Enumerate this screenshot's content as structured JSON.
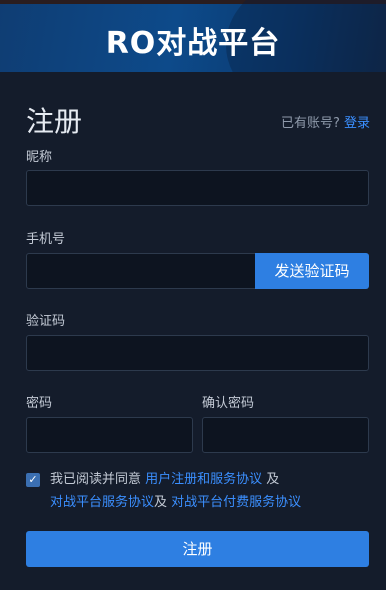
{
  "header": {
    "title": "RO对战平台"
  },
  "form": {
    "heading": "注册",
    "login_prompt": "已有账号?",
    "login_link": "登录",
    "nickname_label": "昵称",
    "phone_label": "手机号",
    "send_code_label": "发送验证码",
    "code_label": "验证码",
    "password_label": "密码",
    "confirm_password_label": "确认密码",
    "agreement": {
      "checked": true,
      "text_1": "我已阅读并同意 ",
      "link_1": "用户注册和服务协议",
      "text_2": " 及",
      "link_2": "对战平台服务协议",
      "text_3": "及 ",
      "link_3": "对战平台付费服务协议"
    },
    "submit_label": "注册"
  },
  "colors": {
    "accent": "#2e7fe2",
    "link": "#3b8fff",
    "background": "#141c2b"
  }
}
